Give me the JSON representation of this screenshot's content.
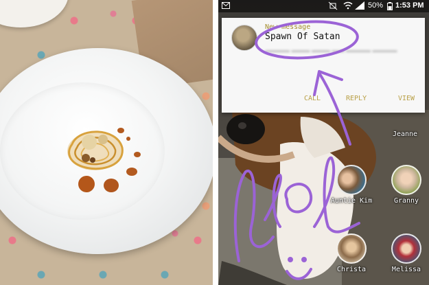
{
  "status_bar": {
    "battery_percent": "50%",
    "time": "1:53 PM",
    "icons": [
      "mail-icon",
      "mute-icon",
      "wifi-icon",
      "signal-icon",
      "battery-icon"
    ]
  },
  "notification": {
    "kind": "New message",
    "sender": "Spawn Of Satan",
    "actions": {
      "call": "CALL",
      "reply": "REPLY",
      "view": "VIEW"
    }
  },
  "contacts": [
    {
      "name": "Jeanne"
    },
    {
      "name": "Auntie Kim"
    },
    {
      "name": "Granny"
    },
    {
      "name": "Christa"
    },
    {
      "name": "Melissa"
    }
  ],
  "annotation": {
    "color": "#9b63d6",
    "handwritten_text": "lol"
  }
}
